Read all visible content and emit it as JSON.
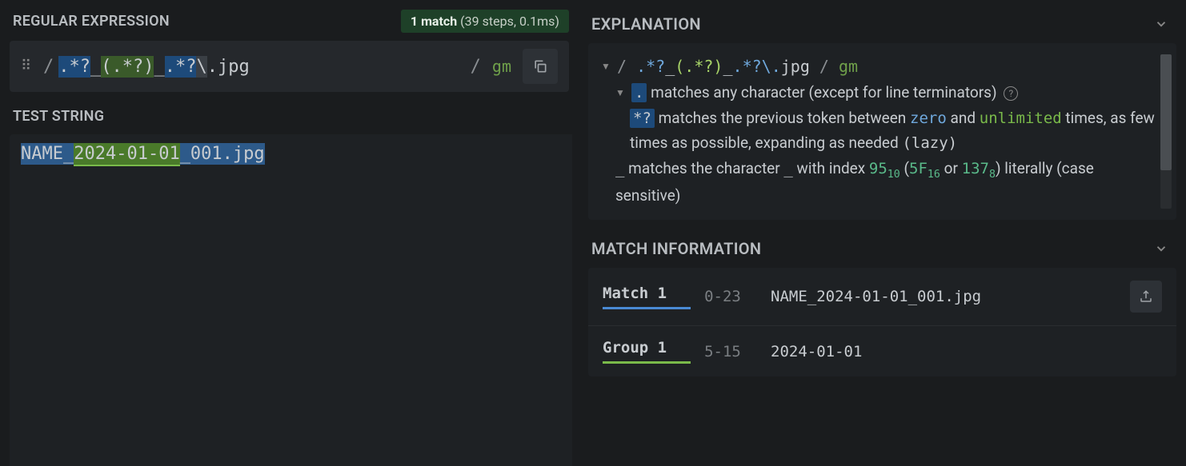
{
  "left": {
    "regex_label": "REGULAR EXPRESSION",
    "match_summary_count": "1 match",
    "match_summary_detail": " (39 steps, 0.1ms)",
    "regex_tokens": {
      "t1": ".*?",
      "t2": "_",
      "t3": "(.*?)",
      "t4": "_",
      "t5": ".*?",
      "t6": "\\",
      "t7": ".jpg"
    },
    "slash": "/",
    "flags": "gm",
    "test_label": "TEST STRING",
    "test_string": {
      "s1": "NAME_",
      "s2": "2024-01-01",
      "s3": "_001.jpg"
    }
  },
  "exp": {
    "title": "EXPLANATION",
    "line1_regex": {
      "s": "/ ",
      "p1": ".*?",
      "u1": "_",
      "p2": "(.*?)",
      "u2": "_",
      "p3": ".*?",
      "esc": "\\.",
      "ext": "jpg",
      "e": " / ",
      "gm": "gm"
    },
    "r2_tok": ".",
    "r2_text": " matches any character (except for line terminators) ",
    "r3_tok": "*?",
    "r3_a": " matches the previous token between ",
    "r3_zero": "zero",
    "r3_and": " and ",
    "r3_unl": "unlimited",
    "r3_b": " times, as few times as possible, expanding as needed ",
    "r3_lazy": "(lazy)",
    "r4_a": "_",
    "r4_b": " matches the character ",
    "r4_c": "_",
    "r4_d": " with index ",
    "r4_95": "95",
    "r4_10": "10",
    "r4_p1": " (",
    "r4_5f": "5F",
    "r4_16": "16",
    "r4_or": " or ",
    "r4_137": "137",
    "r4_8": "8",
    "r4_p2": ") literally (case sensitive)"
  },
  "mi": {
    "title": "MATCH INFORMATION",
    "rows": [
      {
        "label": "Match 1",
        "range": "0-23",
        "value": "NAME_2024-01-01_001.jpg"
      },
      {
        "label": "Group 1",
        "range": "5-15",
        "value": "2024-01-01"
      }
    ]
  }
}
